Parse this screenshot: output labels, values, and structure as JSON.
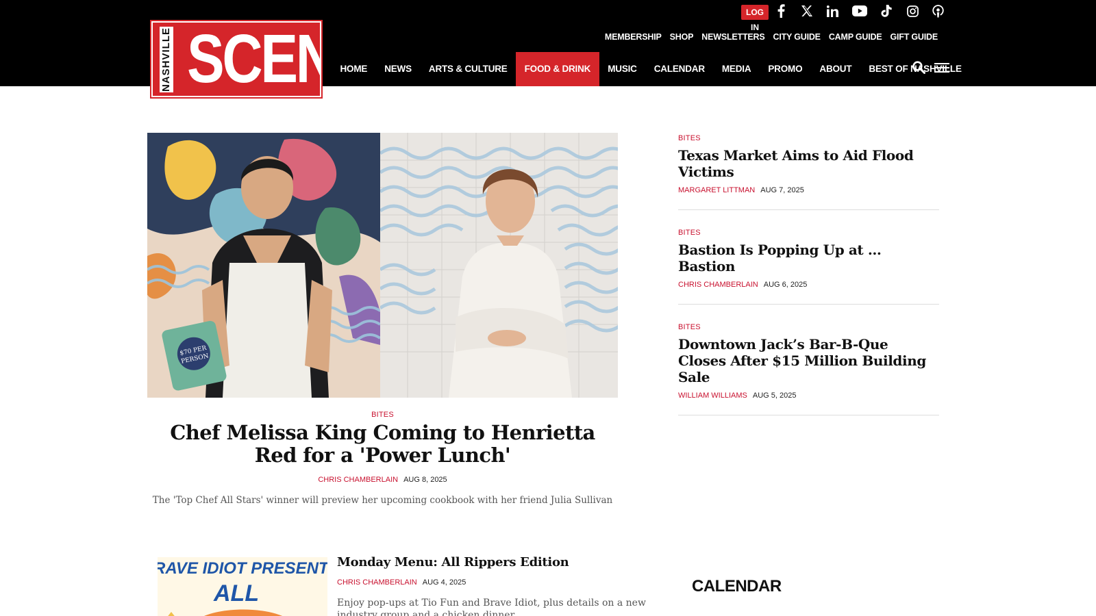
{
  "brand": {
    "logo_small": "NASHVILLE",
    "logo_big": "SCENE",
    "accent": "#d5252a"
  },
  "header": {
    "login_label": "LOG IN",
    "social_icons": [
      "facebook-icon",
      "x-twitter-icon",
      "linkedin-icon",
      "youtube-icon",
      "tiktok-icon",
      "instagram-icon",
      "podcast-icon"
    ],
    "utility_nav": [
      "MEMBERSHIP",
      "SHOP",
      "NEWSLETTERS",
      "CITY GUIDE",
      "CAMP GUIDE",
      "GIFT GUIDE"
    ],
    "main_nav": [
      "HOME",
      "NEWS",
      "ARTS & CULTURE",
      "FOOD & DRINK",
      "MUSIC",
      "CALENDAR",
      "MEDIA",
      "PROMO",
      "ABOUT",
      "BEST OF NASHVILLE"
    ],
    "active_nav": "FOOD & DRINK"
  },
  "feature": {
    "image_badge": "$70 PER PERSON",
    "kicker": "BITES",
    "title": "Chef Melissa King Coming to Henrietta Red for a 'Power Lunch'",
    "author": "CHRIS CHAMBERLAIN",
    "date": "AUG 8, 2025",
    "dek": "The 'Top Chef All Stars' winner will preview her upcoming cookbook with her friend Julia Sullivan"
  },
  "sidebar": [
    {
      "kicker": "BITES",
      "title": "Texas Market Aims to Aid Flood Victims",
      "author": "MARGARET LITTMAN",
      "date": "AUG 7, 2025"
    },
    {
      "kicker": "BITES",
      "title": "Bastion Is Popping Up at … Bastion",
      "author": "CHRIS CHAMBERLAIN",
      "date": "AUG 6, 2025"
    },
    {
      "kicker": "BITES",
      "title": "Downtown Jack’s Bar-B-Que Closes After $15 Million Building Sale",
      "author": "WILLIAM WILLIAMS",
      "date": "AUG 5, 2025"
    }
  ],
  "bottom_story": {
    "thumb_text_1": "RAVE IDIOT PRESENTS",
    "thumb_text_2": "ALL",
    "title": "Monday Menu: All Rippers Edition",
    "author": "CHRIS CHAMBERLAIN",
    "date": "AUG 4, 2025",
    "dek": "Enjoy pop-ups at Tio Fun and Brave Idiot, plus details on a new industry group and a chicken dinner"
  },
  "calendar_heading": "CALENDAR"
}
